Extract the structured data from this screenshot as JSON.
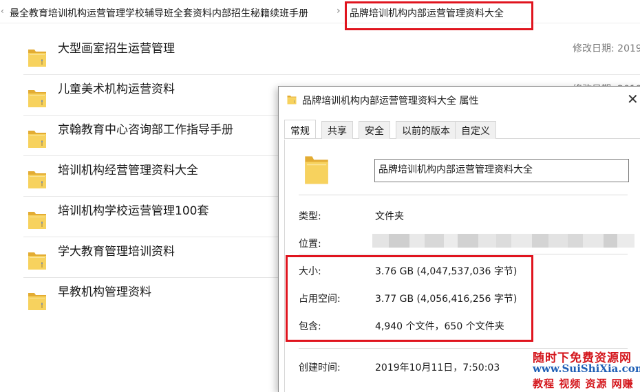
{
  "breadcrumb": {
    "parent": "最全教育培训机构运营管理学校辅导班全套资料内部招生秘籍续班手册",
    "separator": "›",
    "current": "品牌培训机构内部运营管理资料大全"
  },
  "list": {
    "items": [
      {
        "name": "大型画室招生运营管理",
        "date_label": "修改日期: 2019"
      },
      {
        "name": "儿童美术机构运营资料",
        "date_label": "修改日期: 2019"
      },
      {
        "name": "京翰教育中心咨询部工作指导手册"
      },
      {
        "name": "培训机构经营管理资料大全"
      },
      {
        "name": "培训机构学校运营管理100套"
      },
      {
        "name": "学大教育管理培训资料"
      },
      {
        "name": "早教机构管理资料"
      }
    ]
  },
  "dialog": {
    "title": "品牌培训机构内部运营管理资料大全 属性",
    "close": "✕",
    "tabs": [
      "常规",
      "共享",
      "安全",
      "以前的版本",
      "自定义"
    ],
    "active_tab": "常规",
    "folder_name": "品牌培训机构内部运营管理资料大全",
    "properties": {
      "type_label": "类型:",
      "type_value": "文件夹",
      "location_label": "位置:",
      "size_label": "大小:",
      "size_value": "3.76 GB (4,047,537,036 字节)",
      "disk_label": "占用空间:",
      "disk_value": "3.77 GB (4,056,416,256 字节)",
      "contains_label": "包含:",
      "contains_value": "4,940 个文件，650 个文件夹",
      "created_label": "创建时间:",
      "created_value": "2019年10月11日，7:50:03"
    }
  },
  "watermark": {
    "line1": "随时下免费资源网",
    "line2": "www.SuiShiXia.com",
    "line3": "教程 视频 资源 网赚"
  },
  "colors": {
    "highlight_red": "#e0141e",
    "folder_yellow": "#f5c94c"
  }
}
